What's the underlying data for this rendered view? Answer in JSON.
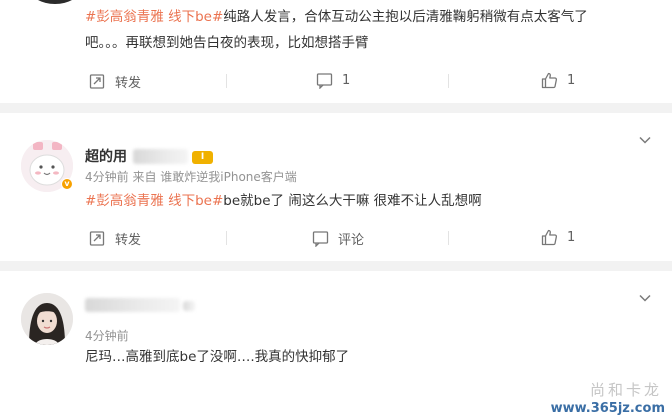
{
  "comments": [
    {
      "text_line1_topic": "#彭高翁青雅 线下be#",
      "text_line1_rest": "纯路人发言，合体互动公主抱以后清雅鞠躬稍微有点太客气了",
      "text_line2": "吧。。。再联想到她告白夜的表现，比如想搭手臂",
      "actions": {
        "repost_label": "转发",
        "comment_label": "1",
        "like_count": "1"
      }
    },
    {
      "username": "超的用",
      "verified_icon": "verified-v-icon",
      "level_badge": "Ⅰ",
      "meta": "4分钟前  来自 谁敢炸逆我iPhone客户端",
      "text_topic": "#彭高翁青雅 线下be#",
      "text_rest": "be就be了 闹这么大干嘛 很难不让人乱想啊",
      "actions": {
        "repost_label": "转发",
        "comment_label": "评论",
        "like_count": "1"
      }
    },
    {
      "meta": "4分钟前",
      "text": "尼玛…高雅到底be了没啊….我真的快抑郁了"
    }
  ],
  "watermark": {
    "url": "www.365jz.com",
    "cn": "尚和卡龙"
  },
  "colors": {
    "topic": "#eb7350",
    "meta": "#939393",
    "badge": "#f7a100"
  }
}
